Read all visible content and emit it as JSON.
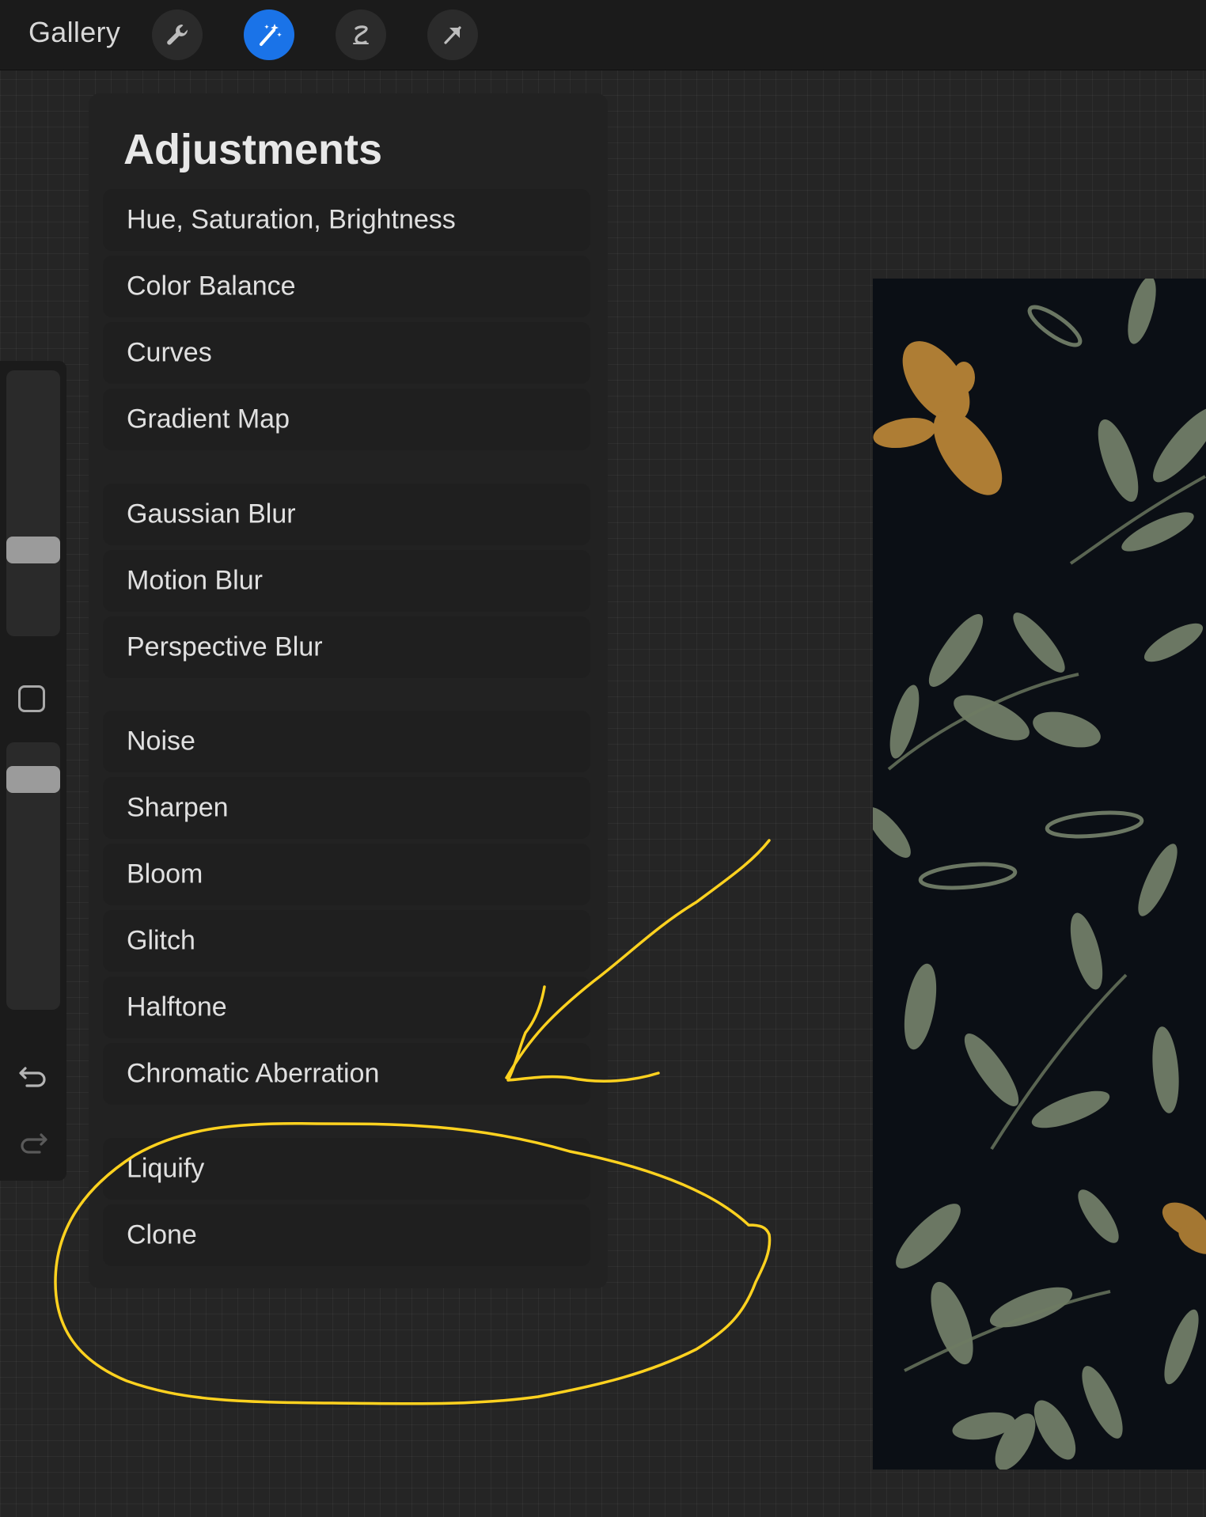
{
  "topbar": {
    "gallery_label": "Gallery",
    "tools": [
      {
        "name": "actions",
        "icon": "wrench-icon",
        "active": false
      },
      {
        "name": "adjustments",
        "icon": "magic-wand-icon",
        "active": true
      },
      {
        "name": "selection",
        "icon": "selection-s-icon",
        "active": false
      },
      {
        "name": "transform",
        "icon": "arrow-cursor-icon",
        "active": false
      }
    ],
    "accent_color": "#1a73e8"
  },
  "sidebar": {
    "icons": [
      "brush-size-slider",
      "modify-square-icon",
      "opacity-slider",
      "undo-icon",
      "redo-icon"
    ]
  },
  "adjustments": {
    "title": "Adjustments",
    "groups": [
      [
        "Hue, Saturation, Brightness",
        "Color Balance",
        "Curves",
        "Gradient Map"
      ],
      [
        "Gaussian Blur",
        "Motion Blur",
        "Perspective Blur"
      ],
      [
        "Noise",
        "Sharpen",
        "Bloom",
        "Glitch",
        "Halftone",
        "Chromatic Aberration"
      ],
      [
        "Liquify",
        "Clone"
      ]
    ]
  },
  "annotation_color": "#ffd21f"
}
